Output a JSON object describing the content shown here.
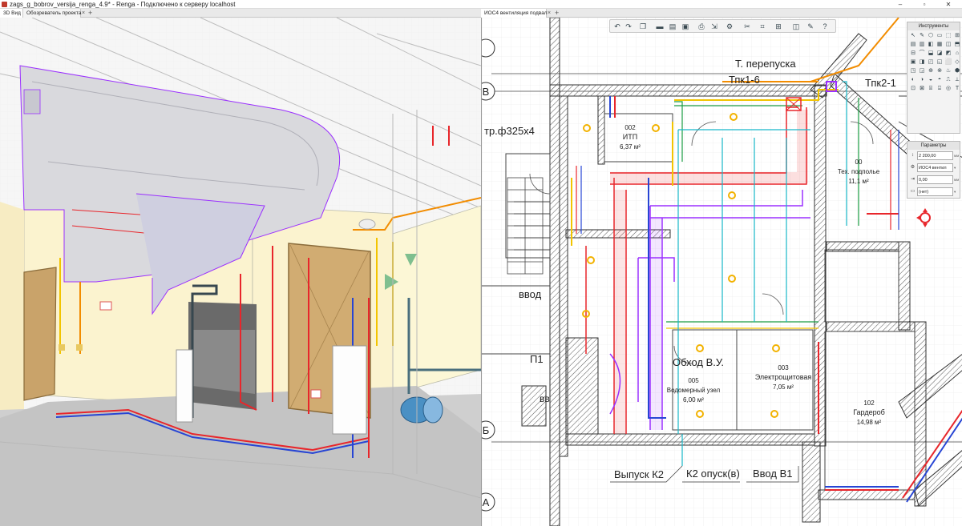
{
  "window": {
    "title": "zags_g_bobrov_versija_renga_4.9* - Renga - Подключено к серверу localhost",
    "controls": [
      "–",
      "▫",
      "✕"
    ]
  },
  "left_tabs": [
    {
      "label": "3D Вид"
    },
    {
      "label": "Обозреватель проекта"
    }
  ],
  "right_tabs": [
    {
      "label": "ИОС4 вентиляция подвал"
    }
  ],
  "plan_labels": {
    "t_perepuska": "Т. перепуска",
    "tpk1_6": "Тпк1-6",
    "tpk2_1": "Тпк2-1",
    "tr325": "тр.ф325х4",
    "vvod": "ввод",
    "p1": "П1",
    "obhod": "Обход В.У.",
    "vypusk": "Выпуск К2",
    "k2_opusk": "К2 опуск(в)",
    "vvod_v1": "Ввод В1",
    "axis_v": "В",
    "axis_b": "Б",
    "axis_a": "А",
    "room_vv": "вв"
  },
  "rooms": [
    {
      "num": "002",
      "name": "ИТП",
      "area": "6,37 м²"
    },
    {
      "num": "00",
      "name": "Тех. подполье",
      "area": "11,1 м²"
    },
    {
      "num": "005",
      "name": "Водомерный узел",
      "area": "6,00 м²"
    },
    {
      "num": "003",
      "name": "Электрощитовая",
      "area": "7,05 м²"
    },
    {
      "num": "102",
      "name": "Гардероб",
      "area": "14,98 м²"
    }
  ],
  "toolbar": {
    "icons": [
      "undo-icon",
      "redo-icon",
      "copy-icon",
      "folder-icon",
      "open-icon",
      "save-icon",
      "print-icon",
      "export-icon",
      "cut-icon",
      "paste-icon",
      "measure-icon",
      "settings-icon",
      "help-icon"
    ]
  },
  "tools_panel": {
    "title": "Инструменты",
    "icons": [
      "↖",
      "✎",
      "⬡",
      "▭",
      "⬚",
      "⊞",
      "▤",
      "▥",
      "◧",
      "▦",
      "◫",
      "⬒",
      "⊟",
      "⌒",
      "⬓",
      "◪",
      "◩",
      "⌂",
      "▣",
      "◨",
      "◰",
      "◱",
      "⬜",
      "◇",
      "◳",
      "◲",
      "⊕",
      "⊗",
      "♨",
      "⬢",
      "◐",
      "◑",
      "◒",
      "◓",
      "⎍",
      "⟂",
      "⊡",
      "⊠",
      "⌸",
      "⌹",
      "◎",
      "T"
    ]
  },
  "parameters": {
    "title": "Параметры",
    "rows": [
      {
        "value": "2 200,00",
        "unit": "мм"
      },
      {
        "value": "ИОС4 вентил",
        "unit": "▾"
      },
      {
        "value": "0,00",
        "unit": "мм"
      },
      {
        "value": "(нет)",
        "unit": "▾"
      }
    ]
  },
  "colors": {
    "supply_air": "#9b30ff",
    "exhaust_air": "#e8262b",
    "heating_supply": "#e8262b",
    "heating_return": "#2745d4",
    "water": "#1a9c44",
    "cold_water": "#18b7c9",
    "gas": "#f2c400",
    "orange": "#f28c00",
    "wall_3d": "#fcf7d6",
    "door": "#c9a36a"
  }
}
